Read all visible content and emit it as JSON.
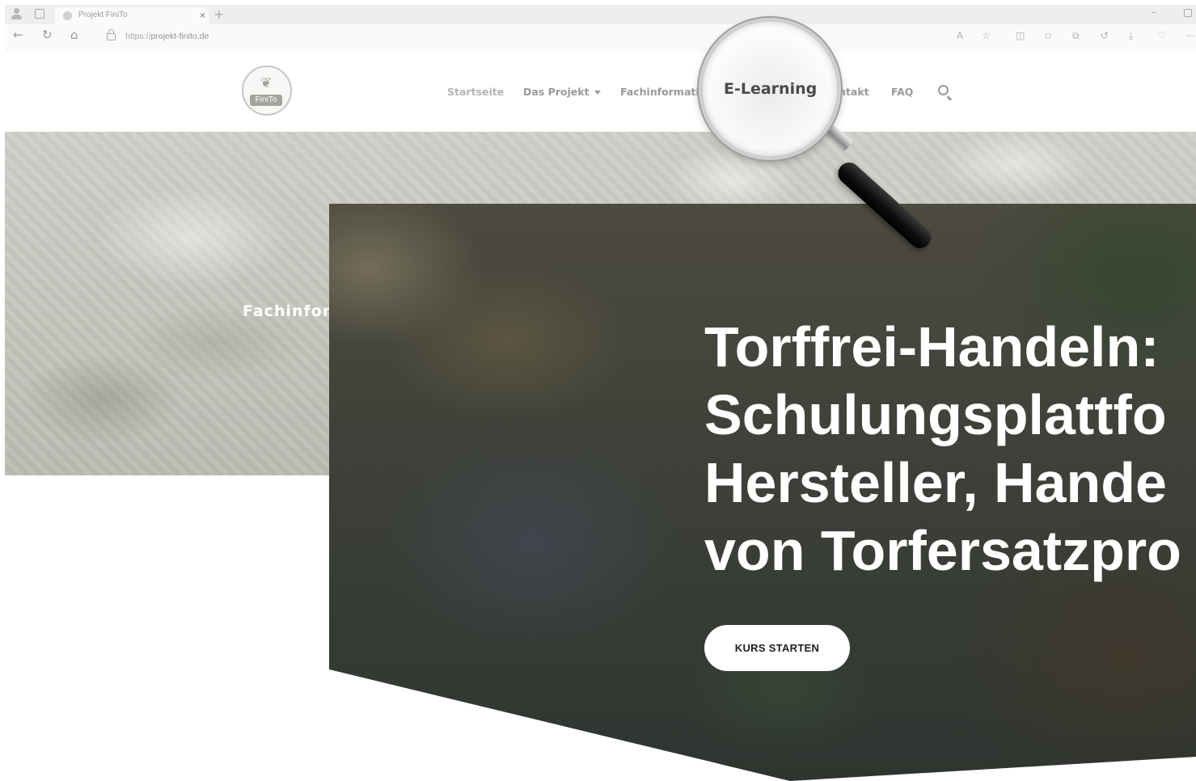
{
  "browser": {
    "tab_title": "Projekt FiniTo",
    "tab_close": "×",
    "new_tab": "+",
    "url_prefix": "https://",
    "url_domain": "projekt-finito.de",
    "min_glyph": "–"
  },
  "site": {
    "logo_text": "FiniTo",
    "menu": {
      "startseite": "Startseite",
      "das_projekt": "Das Projekt",
      "fachinformationen": "Fachinformatione",
      "kontakt": "Kontakt",
      "faq": "FAQ"
    },
    "hero_title": "Fachinfor"
  },
  "magnifier": {
    "text": "E-Learning"
  },
  "elearning": {
    "title_lines": [
      "Torffrei-Handeln:",
      "Schulungsplattfo",
      "Hersteller, Hande",
      "von Torfersatzpro"
    ],
    "cta_label": "KURS STARTEN"
  }
}
